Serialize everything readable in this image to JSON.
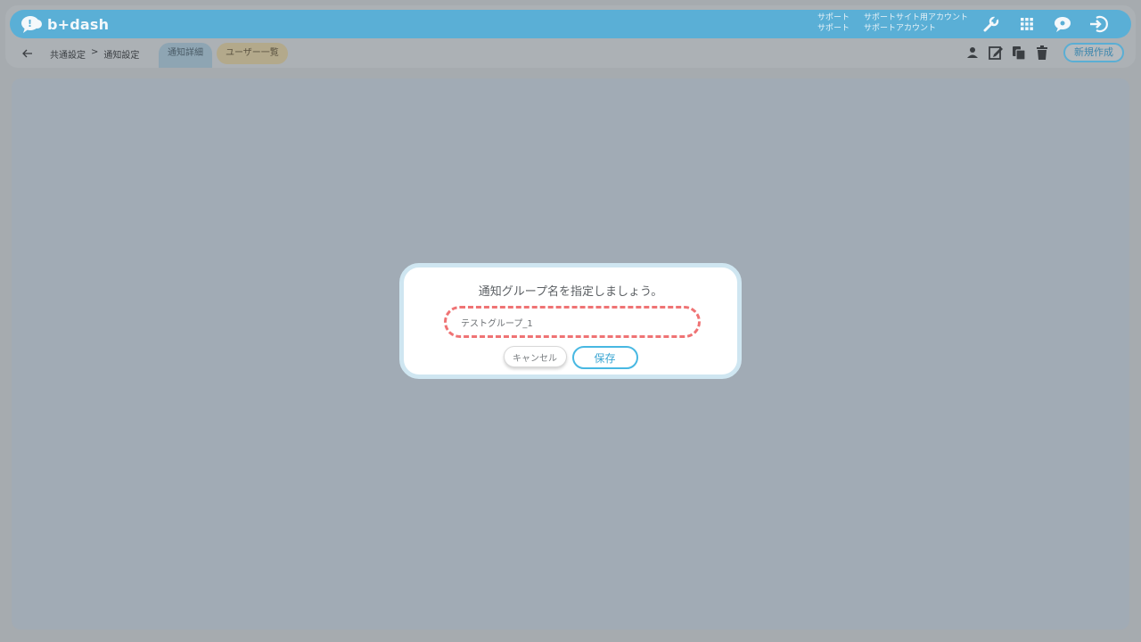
{
  "header": {
    "logo_text": "b+dash",
    "support": [
      {
        "key": "サポート",
        "value": "サポートサイト用アカウント"
      },
      {
        "key": "サポート",
        "value": "サポートアカウント"
      }
    ],
    "icons": [
      "wrench-icon",
      "grid-icon",
      "chat-icon",
      "logout-icon"
    ]
  },
  "subbar": {
    "breadcrumb": [
      "共通設定",
      ">",
      "通知設定"
    ],
    "tabs": [
      {
        "label": "通知詳細"
      },
      {
        "label": "ユーザー一覧"
      }
    ],
    "icons": [
      "user-icon",
      "edit-icon",
      "copy-icon",
      "trash-icon"
    ],
    "new_button_label": "新規作成"
  },
  "dialog": {
    "title": "通知グループ名を指定しましょう。",
    "input_value": "テストグループ_1",
    "cancel_label": "キャンセル",
    "save_label": "保存"
  },
  "colors": {
    "accent": "#5aafd6",
    "save": "#3aa5d2",
    "input_border": "#ef7374"
  }
}
